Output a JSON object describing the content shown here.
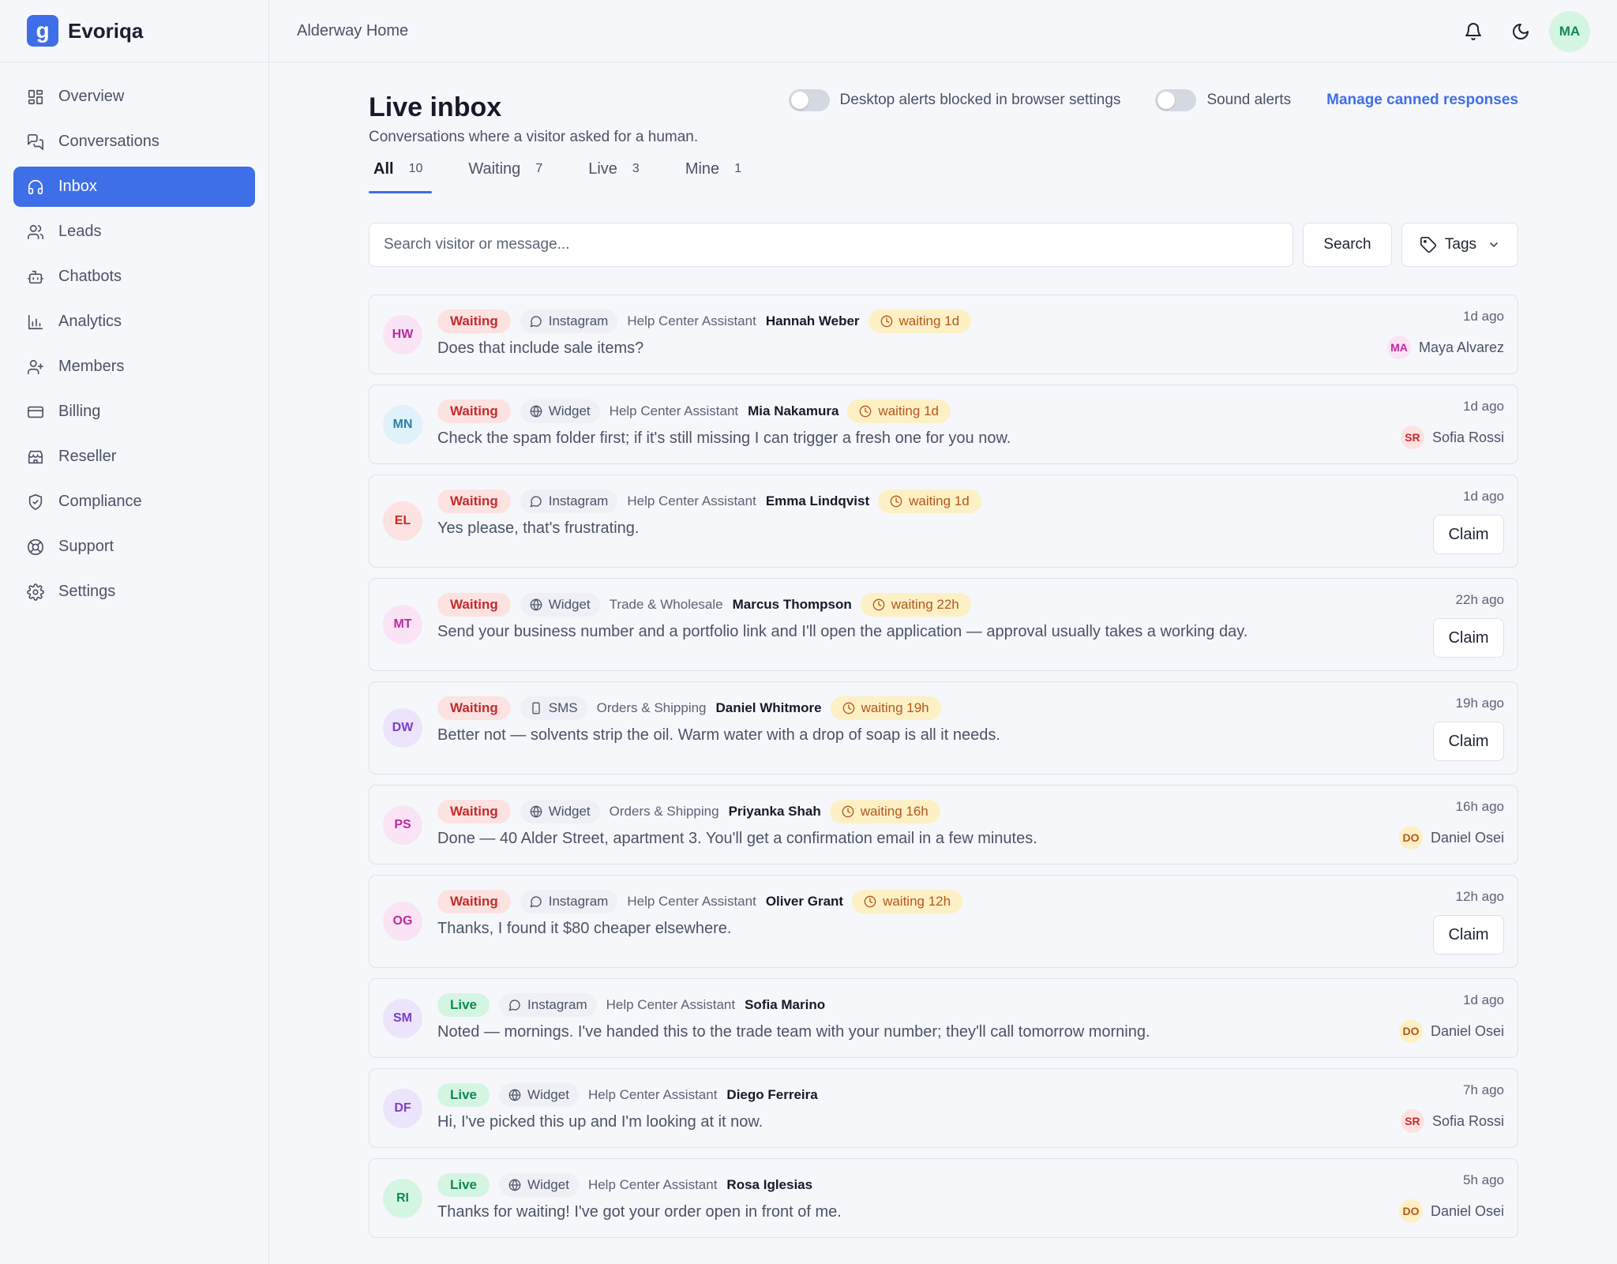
{
  "brand": {
    "name": "Evoriqa",
    "logo_letter": "g",
    "accent": "#3e6ee8"
  },
  "topbar": {
    "org": "Alderway Home",
    "user_initials": "MA"
  },
  "sidebar": {
    "items": [
      {
        "label": "Overview",
        "icon": "grid-icon"
      },
      {
        "label": "Conversations",
        "icon": "chat-icon"
      },
      {
        "label": "Inbox",
        "icon": "headset-icon",
        "active": true
      },
      {
        "label": "Leads",
        "icon": "users-icon"
      },
      {
        "label": "Chatbots",
        "icon": "bot-icon"
      },
      {
        "label": "Analytics",
        "icon": "bar-chart-icon"
      },
      {
        "label": "Members",
        "icon": "user-plus-icon"
      },
      {
        "label": "Billing",
        "icon": "card-icon"
      },
      {
        "label": "Reseller",
        "icon": "store-icon"
      },
      {
        "label": "Compliance",
        "icon": "shield-icon"
      },
      {
        "label": "Support",
        "icon": "lifebuoy-icon"
      },
      {
        "label": "Settings",
        "icon": "gear-icon"
      }
    ]
  },
  "page": {
    "title": "Live inbox",
    "subtitle": "Conversations where a visitor asked for a human.",
    "desktop_alerts_label": "Desktop alerts blocked in browser settings",
    "sound_alerts_label": "Sound alerts",
    "manage_link": "Manage canned responses"
  },
  "tabs": [
    {
      "label": "All",
      "count": "10",
      "active": true
    },
    {
      "label": "Waiting",
      "count": "7"
    },
    {
      "label": "Live",
      "count": "3"
    },
    {
      "label": "Mine",
      "count": "1"
    }
  ],
  "search": {
    "placeholder": "Search visitor or message...",
    "button": "Search",
    "tags": "Tags"
  },
  "conversations": [
    {
      "initials": "HW",
      "av_bg": "#fbe3f6",
      "av_fg": "#b82b9e",
      "status": "Waiting",
      "channel": "Instagram",
      "bot": "Help Center Assistant",
      "visitor": "Hannah Weber",
      "wait": "waiting 1d",
      "message": "Does that include sale items?",
      "time": "1d ago",
      "assignee": {
        "initials": "MA",
        "name": "Maya Alvarez",
        "bg": "#fbe3f6",
        "fg": "#b82b9e"
      }
    },
    {
      "initials": "MN",
      "av_bg": "#dff1fb",
      "av_fg": "#2a7fa8",
      "status": "Waiting",
      "channel": "Widget",
      "bot": "Help Center Assistant",
      "visitor": "Mia Nakamura",
      "wait": "waiting 1d",
      "message": "Check the spam folder first; if it's still missing I can trigger a fresh one for you now.",
      "time": "1d ago",
      "assignee": {
        "initials": "SR",
        "name": "Sofia Rossi",
        "bg": "#fde2e2",
        "fg": "#c42b2b"
      }
    },
    {
      "initials": "EL",
      "av_bg": "#fde2e2",
      "av_fg": "#c42b2b",
      "status": "Waiting",
      "channel": "Instagram",
      "bot": "Help Center Assistant",
      "visitor": "Emma Lindqvist",
      "wait": "waiting 1d",
      "message": "Yes please, that's frustrating.",
      "time": "1d ago",
      "claim": "Claim"
    },
    {
      "initials": "MT",
      "av_bg": "#fbe3f6",
      "av_fg": "#b82b9e",
      "status": "Waiting",
      "channel": "Widget",
      "bot": "Trade & Wholesale",
      "visitor": "Marcus Thompson",
      "wait": "waiting 22h",
      "message": "Send your business number and a portfolio link and I'll open the application — approval usually takes a working day.",
      "time": "22h ago",
      "claim": "Claim"
    },
    {
      "initials": "DW",
      "av_bg": "#ece4fb",
      "av_fg": "#7a3fc8",
      "status": "Waiting",
      "channel": "SMS",
      "bot": "Orders & Shipping",
      "visitor": "Daniel Whitmore",
      "wait": "waiting 19h",
      "message": "Better not — solvents strip the oil. Warm water with a drop of soap is all it needs.",
      "time": "19h ago",
      "claim": "Claim"
    },
    {
      "initials": "PS",
      "av_bg": "#fbe3f6",
      "av_fg": "#b82b9e",
      "status": "Waiting",
      "channel": "Widget",
      "bot": "Orders & Shipping",
      "visitor": "Priyanka Shah",
      "wait": "waiting 16h",
      "message": "Done — 40 Alder Street, apartment 3. You'll get a confirmation email in a few minutes.",
      "time": "16h ago",
      "assignee": {
        "initials": "DO",
        "name": "Daniel Osei",
        "bg": "#fdf0c4",
        "fg": "#b4571e"
      }
    },
    {
      "initials": "OG",
      "av_bg": "#fbe3f6",
      "av_fg": "#b82b9e",
      "status": "Waiting",
      "channel": "Instagram",
      "bot": "Help Center Assistant",
      "visitor": "Oliver Grant",
      "wait": "waiting 12h",
      "message": "Thanks, I found it $80 cheaper elsewhere.",
      "time": "12h ago",
      "claim": "Claim"
    },
    {
      "initials": "SM",
      "av_bg": "#ece4fb",
      "av_fg": "#7a3fc8",
      "status": "Live",
      "channel": "Instagram",
      "bot": "Help Center Assistant",
      "visitor": "Sofia Marino",
      "message": "Noted — mornings. I've handed this to the trade team with your number; they'll call tomorrow morning.",
      "time": "1d ago",
      "assignee": {
        "initials": "DO",
        "name": "Daniel Osei",
        "bg": "#fdf0c4",
        "fg": "#b4571e"
      }
    },
    {
      "initials": "DF",
      "av_bg": "#ece4fb",
      "av_fg": "#7a3fc8",
      "status": "Live",
      "channel": "Widget",
      "bot": "Help Center Assistant",
      "visitor": "Diego Ferreira",
      "message": "Hi, I've picked this up and I'm looking at it now.",
      "time": "7h ago",
      "assignee": {
        "initials": "SR",
        "name": "Sofia Rossi",
        "bg": "#fde2e2",
        "fg": "#c42b2b"
      }
    },
    {
      "initials": "RI",
      "av_bg": "#d5f5e3",
      "av_fg": "#0f8a52",
      "status": "Live",
      "channel": "Widget",
      "bot": "Help Center Assistant",
      "visitor": "Rosa Iglesias",
      "message": "Thanks for waiting! I've got your order open in front of me.",
      "time": "5h ago",
      "assignee": {
        "initials": "DO",
        "name": "Daniel Osei",
        "bg": "#fdf0c4",
        "fg": "#b4571e"
      }
    }
  ]
}
